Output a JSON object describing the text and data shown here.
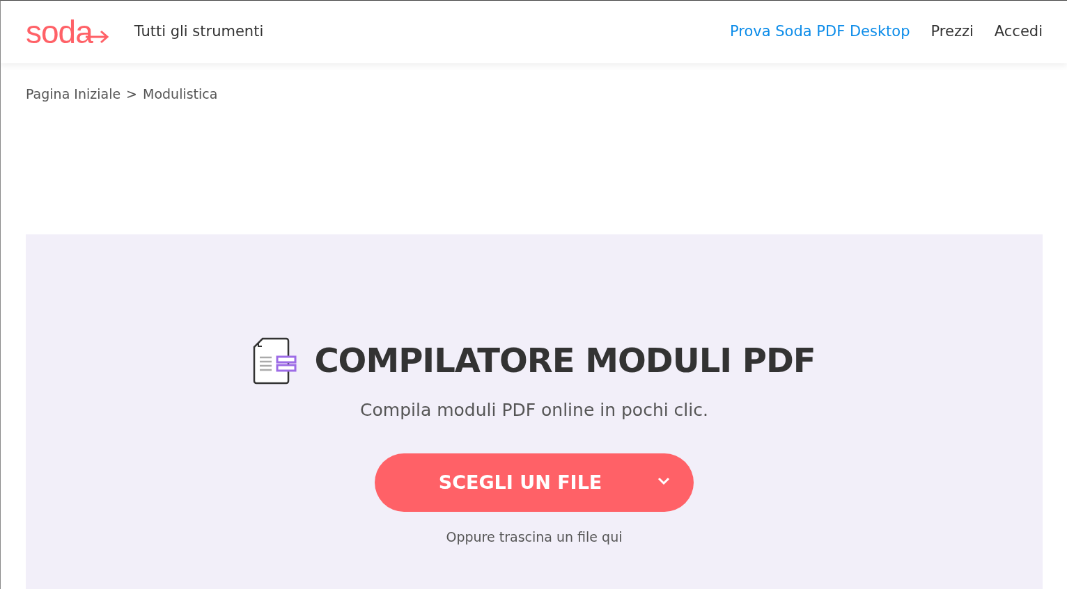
{
  "header": {
    "logo": "soda",
    "menu_link": "Tutti gli strumenti",
    "nav": [
      {
        "label": "Prova Soda PDF Desktop",
        "kind": "promo"
      },
      {
        "label": "Prezzi",
        "kind": "plain"
      },
      {
        "label": "Accedi",
        "kind": "plain"
      }
    ]
  },
  "breadcrumb": {
    "separator": ">",
    "items": [
      {
        "label": "Pagina Iniziale"
      },
      {
        "label": "Modulistica"
      }
    ]
  },
  "hero": {
    "title": "COMPILATORE MODULI PDF",
    "subtitle": "Compila moduli PDF online in pochi clic.",
    "button": "SCEGLI UN FILE",
    "hint": "Oppure trascina un file qui"
  }
}
